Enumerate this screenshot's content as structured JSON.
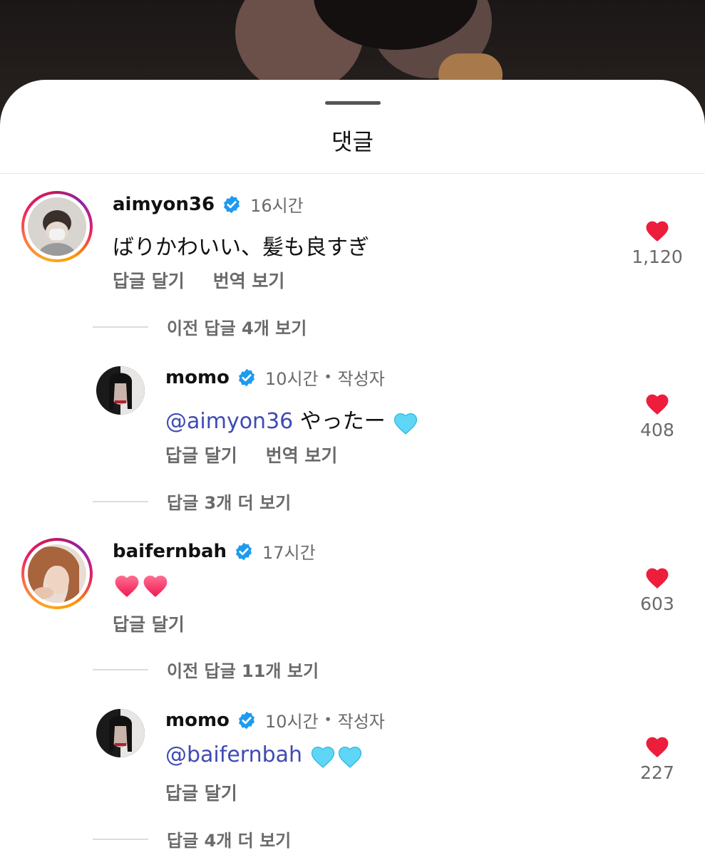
{
  "sheet": {
    "title": "댓글"
  },
  "comments": [
    {
      "username": "aimyon36",
      "time": "16시간",
      "text": "ばりかわいい、髪も良すぎ",
      "actions": [
        "답글 달기",
        "번역 보기"
      ],
      "likes": "1,120",
      "more_replies": "이전 답글 4개 보기"
    },
    {
      "username": "momo",
      "time": "10시간",
      "author_tag": "작성자",
      "mention": "@aimyon36",
      "text": " やったー",
      "actions": [
        "답글 달기",
        "번역 보기"
      ],
      "likes": "408",
      "more_replies": "답글 3개 더 보기"
    },
    {
      "username": "baifernbah",
      "time": "17시간",
      "actions": [
        "답글 달기"
      ],
      "likes": "603",
      "more_replies": "이전 답글 11개 보기"
    },
    {
      "username": "momo",
      "time": "10시간",
      "author_tag": "작성자",
      "mention": "@baifernbah",
      "actions": [
        "답글 달기"
      ],
      "likes": "227",
      "more_replies": "답글 4개 더 보기"
    }
  ],
  "colors": {
    "heart_red": "#ed1d3c",
    "verified_blue": "#1d9bf0",
    "mention_blue": "#3f4bb3",
    "light_blue_heart": "#5fd6f5",
    "pink_heart": "#ff3d6e"
  },
  "icons": {
    "verified": "verified-badge-icon",
    "like": "heart-icon",
    "handle": "drag-handle-icon"
  }
}
